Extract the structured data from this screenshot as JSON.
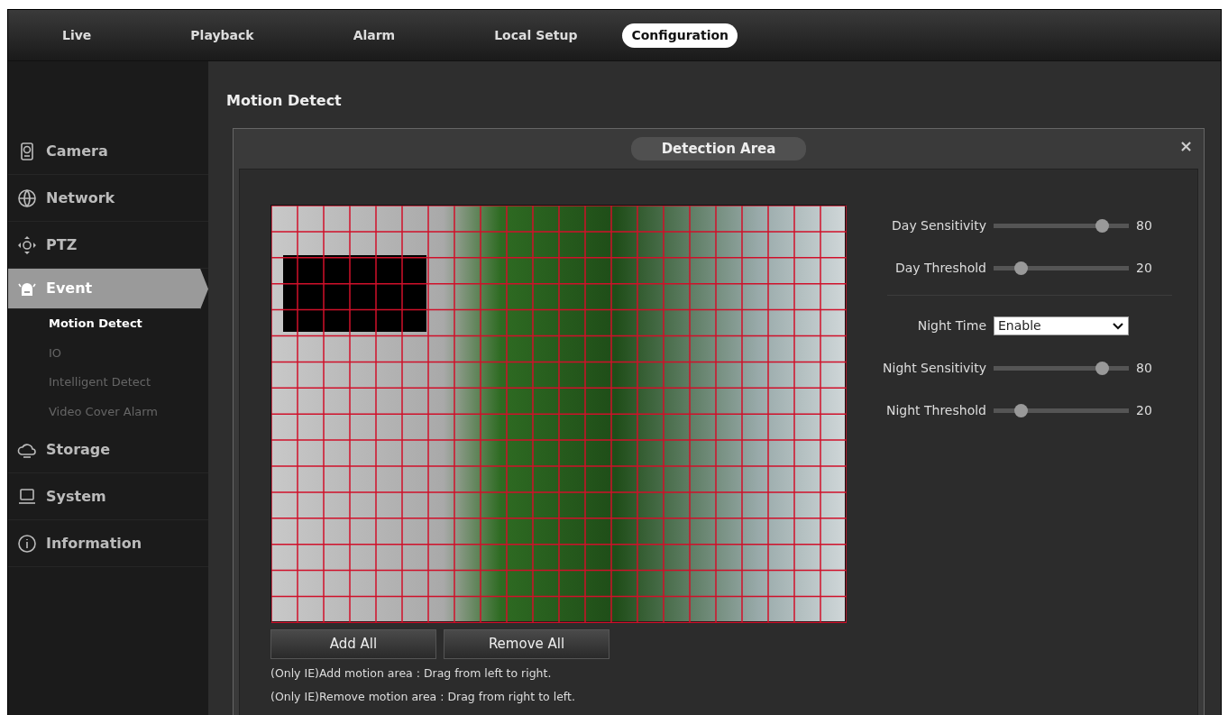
{
  "top_nav": [
    {
      "label": "Live",
      "selected": false
    },
    {
      "label": "Playback",
      "selected": false
    },
    {
      "label": "Alarm",
      "selected": false
    },
    {
      "label": "Local Setup",
      "selected": false
    },
    {
      "label": "Configuration",
      "selected": true
    }
  ],
  "sidebar": {
    "items": [
      {
        "label": "Camera",
        "kind": "camera",
        "selected": false
      },
      {
        "label": "Network",
        "kind": "network",
        "selected": false
      },
      {
        "label": "PTZ",
        "kind": "ptz",
        "selected": false
      },
      {
        "label": "Event",
        "kind": "event",
        "selected": true,
        "children": [
          {
            "label": "Motion Detect",
            "selected": true
          },
          {
            "label": "IO",
            "selected": false
          },
          {
            "label": "Intelligent Detect",
            "selected": false
          },
          {
            "label": "Video Cover Alarm",
            "selected": false
          }
        ]
      },
      {
        "label": "Storage",
        "kind": "storage",
        "selected": false
      },
      {
        "label": "System",
        "kind": "system",
        "selected": false
      },
      {
        "label": "Information",
        "kind": "info",
        "selected": false
      }
    ]
  },
  "page_title": "Motion Detect",
  "dialog": {
    "title": "Detection Area",
    "close": "×",
    "buttons": [
      "Add All",
      "Remove All"
    ],
    "notes": [
      "(Only IE)Add motion area : Drag from left to right.",
      "(Only IE)Remove motion area : Drag from right to left."
    ],
    "settings": [
      {
        "kind": "slider",
        "label": "Day Sensitivity",
        "level": 0.8,
        "reading": "80"
      },
      {
        "kind": "slider",
        "label": "Day Threshold",
        "level": 0.2,
        "reading": "20"
      },
      {
        "kind": "divider"
      },
      {
        "kind": "select",
        "label": "Night Time",
        "value": "Enable"
      },
      {
        "kind": "slider",
        "label": "Night Sensitivity",
        "level": 0.8,
        "reading": "80"
      },
      {
        "kind": "slider",
        "label": "Night Threshold",
        "level": 0.2,
        "reading": "20"
      }
    ]
  }
}
